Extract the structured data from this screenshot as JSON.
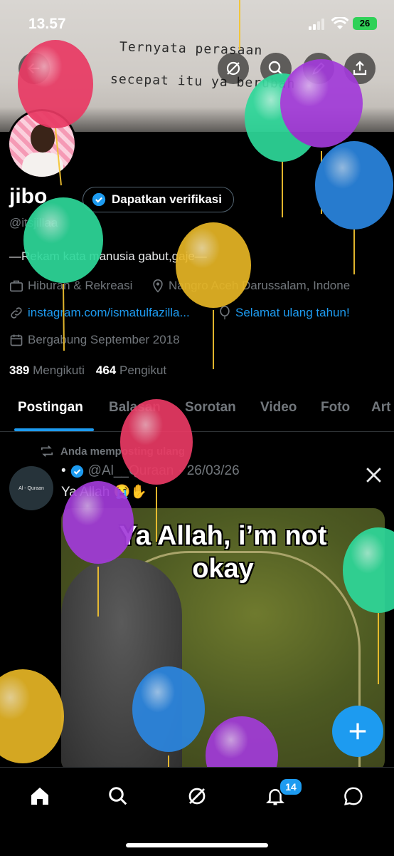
{
  "status_bar": {
    "time": "13.57",
    "battery": "26"
  },
  "banner": {
    "line1": "Ternyata perasaan",
    "line2": "secepat itu ya berubah"
  },
  "profile": {
    "display_name": "jibo",
    "verify_button": "Dapatkan verifikasi",
    "handle": "@itsjillaa",
    "bio": "—Rekam kata manusia gabut,gaje—",
    "category": "Hiburan & Rekreasi",
    "location": "Nangro Aceh Darussalam, Indone",
    "website": "instagram.com/ismatulfazilla...",
    "birthday": "Selamat ulang tahun!",
    "joined": "Bergabung September 2018",
    "following_count": "389",
    "following_label": "Mengikuti",
    "followers_count": "464",
    "followers_label": "Pengikut"
  },
  "tabs": [
    "Postingan",
    "Balasan",
    "Sorotan",
    "Video",
    "Foto",
    "Art"
  ],
  "post": {
    "repost_label": "Anda memposting ulang",
    "avatar_text": "Al - Quraan",
    "author_handle": "@Al__Quraan",
    "date": "26/03/26",
    "text": "Ya Allah 😭✋",
    "image_text_line1": "Ya Allah, i’m not",
    "image_text_line2": "okay"
  },
  "nav": {
    "notification_count": "14"
  },
  "colors": {
    "accent": "#1d9bf0",
    "background": "#000000",
    "muted": "#71767b"
  },
  "icons": [
    "back-arrow-icon",
    "grok-icon",
    "search-icon",
    "edit-icon",
    "share-icon",
    "verified-badge-icon",
    "briefcase-icon",
    "location-pin-icon",
    "link-icon",
    "balloon-icon",
    "calendar-icon",
    "repost-icon",
    "x-logo-icon",
    "plus-icon",
    "home-icon",
    "explore-icon",
    "notifications-icon",
    "messages-icon"
  ]
}
